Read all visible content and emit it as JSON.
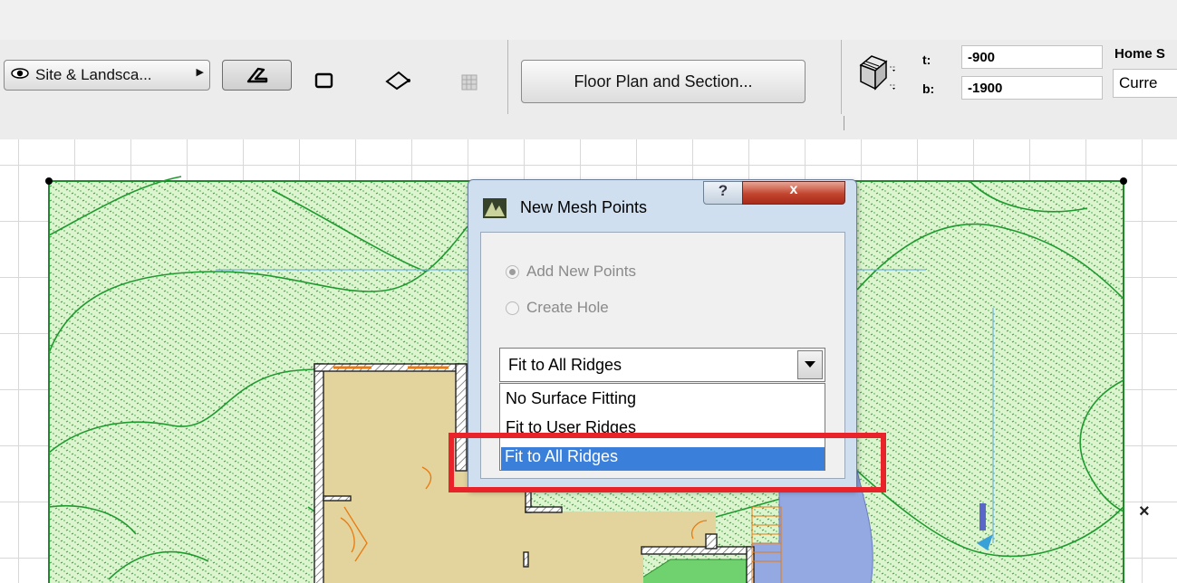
{
  "toolbar": {
    "layer_popup_label": "Site & Landsca...",
    "floor_plan_button_label": "Floor Plan and Section...",
    "top_label": "t:",
    "top_value": "-900",
    "bottom_label": "b:",
    "bottom_value": "-1900",
    "home_label": "Home S",
    "home_value": "Curre"
  },
  "dialog": {
    "title": "New Mesh Points",
    "help_label": "?",
    "close_label": "x",
    "radio_add_points": "Add New Points",
    "radio_create_hole": "Create Hole",
    "select_value": "Fit to All Ridges",
    "options": [
      "No Surface Fitting",
      "Fit to User Ridges",
      "Fit to All Ridges"
    ]
  },
  "canvas": {
    "close_marker": "×"
  },
  "colors": {
    "mesh_fill": "#dcf5cf",
    "contour": "#2aa43a",
    "floor": "#e3d39c",
    "water": "#94a9e1",
    "highlight": "#e8232a",
    "selection": "#3a7fd9"
  }
}
